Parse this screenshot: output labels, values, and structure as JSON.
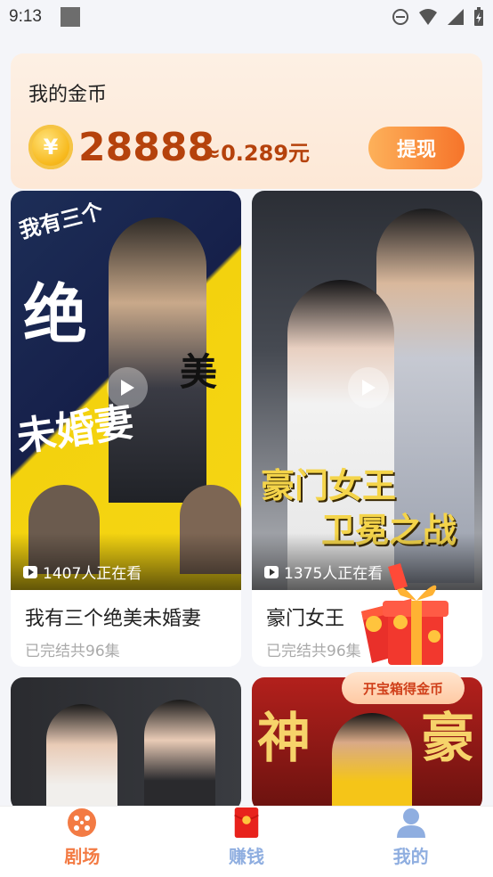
{
  "status_bar": {
    "time": "9:13"
  },
  "coin_card": {
    "title": "我的金币",
    "coin_symbol": "¥",
    "amount": "28888",
    "approx_value": "≈0.289元",
    "withdraw_label": "提现"
  },
  "dramas": [
    {
      "title": "我有三个绝美未婚妻",
      "subtitle": "已完结共96集",
      "viewers": "1407人正在看",
      "poster_text": [
        "我有三个",
        "绝",
        "美",
        "未婚妻"
      ]
    },
    {
      "title": "豪门女王",
      "subtitle": "已完结共96集",
      "viewers": "1375人正在看",
      "poster_text": [
        "豪门女王",
        "卫冕之战"
      ]
    },
    {
      "title": "",
      "subtitle": "",
      "viewers": ""
    },
    {
      "title": "",
      "subtitle": "",
      "viewers": "",
      "poster_text": [
        "神",
        "豪"
      ]
    }
  ],
  "treasure": {
    "label": "开宝箱得金币"
  },
  "nav": {
    "items": [
      {
        "label": "剧场",
        "icon": "film-reel-icon",
        "active": true
      },
      {
        "label": "赚钱",
        "icon": "red-envelope-icon",
        "active": false
      },
      {
        "label": "我的",
        "icon": "user-icon",
        "active": false
      }
    ]
  },
  "colors": {
    "accent": "#f37b44",
    "coin_text": "#b5420c",
    "nav_inactive": "#8faee0"
  }
}
